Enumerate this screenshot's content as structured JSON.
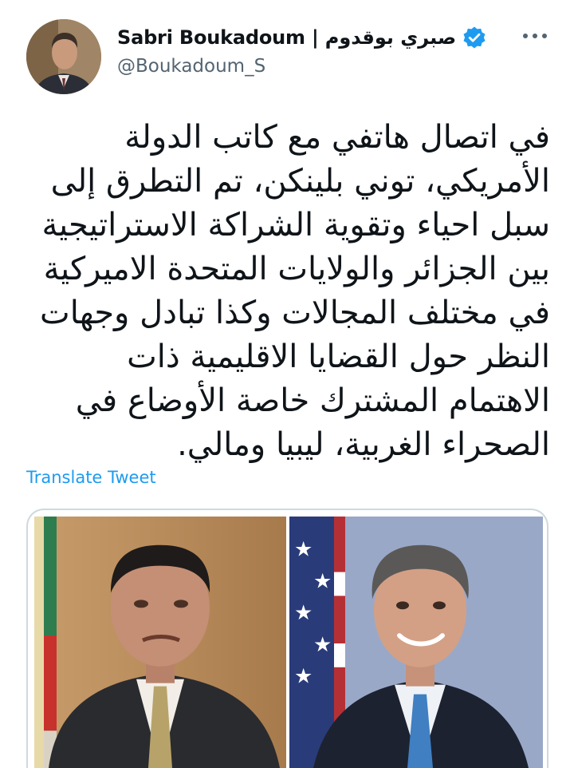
{
  "author": {
    "display_name": "Sabri Boukadoum | صبري بوقدوم",
    "handle": "@Boukadoum_S",
    "verified": true,
    "avatar_icon": "profile-photo-icon"
  },
  "more_menu_icon": "more-horizontal-icon",
  "tweet": {
    "text": "في اتصال هاتفي مع كاتب الدولة الأمريكي، توني بلينكن، تم التطرق إلى سبل احياء وتقوية الشراكة الاستراتيجية بين الجزائر والولايات المتحدة الاميركية في مختلف المجالات وكذا تبادل وجهات النظر حول القضايا الاقليمية ذات الاهتمام المشترك خاصة الأوضاع في الصحراء الغربية، ليبيا ومالي.",
    "translate_label": "Translate Tweet"
  },
  "media": {
    "photos": [
      {
        "icon": "photo-portrait-left"
      },
      {
        "icon": "photo-portrait-right"
      }
    ]
  },
  "colors": {
    "accent": "#1d9bf0",
    "text": "#0f1419",
    "secondary": "#536471",
    "border": "#cfd9de"
  }
}
